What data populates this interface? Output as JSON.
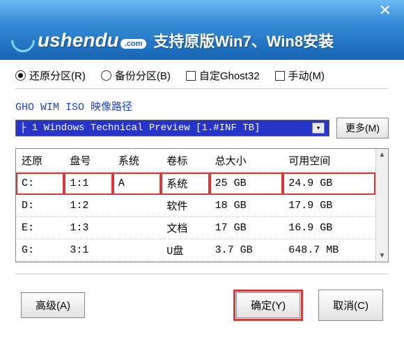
{
  "window": {
    "close": "✕"
  },
  "banner": {
    "logo_text": "ushendu",
    "logo_suffix": ".com",
    "slogan": "支持原版Win7、Win8安装"
  },
  "modes": {
    "restore": "还原分区(R)",
    "backup": "备份分区(B)",
    "ghost": "自定Ghost32",
    "manual": "手动(M)"
  },
  "path": {
    "label": "GHO WIM ISO 映像路径",
    "selected": "├ 1 Windows Technical Preview [1.#INF TB]",
    "more": "更多(M)"
  },
  "table": {
    "headers": [
      "还原",
      "盘号",
      "系统",
      "卷标",
      "总大小",
      "可用空间"
    ],
    "rows": [
      {
        "drive": "C:",
        "num": "1:1",
        "sys": "A",
        "label": "系统",
        "total": "25 GB",
        "free": "24.9 GB",
        "hl": true
      },
      {
        "drive": "D:",
        "num": "1:2",
        "sys": "",
        "label": "软件",
        "total": "18 GB",
        "free": "17.9 GB",
        "hl": false
      },
      {
        "drive": "E:",
        "num": "1:3",
        "sys": "",
        "label": "文档",
        "total": "17 GB",
        "free": "16.9 GB",
        "hl": false
      },
      {
        "drive": "G:",
        "num": "3:1",
        "sys": "",
        "label": "U盘",
        "total": "3.7 GB",
        "free": "648.7 MB",
        "hl": false
      }
    ]
  },
  "footer": {
    "advanced": "高级(A)",
    "ok": "确定(Y)",
    "cancel": "取消(C)"
  }
}
